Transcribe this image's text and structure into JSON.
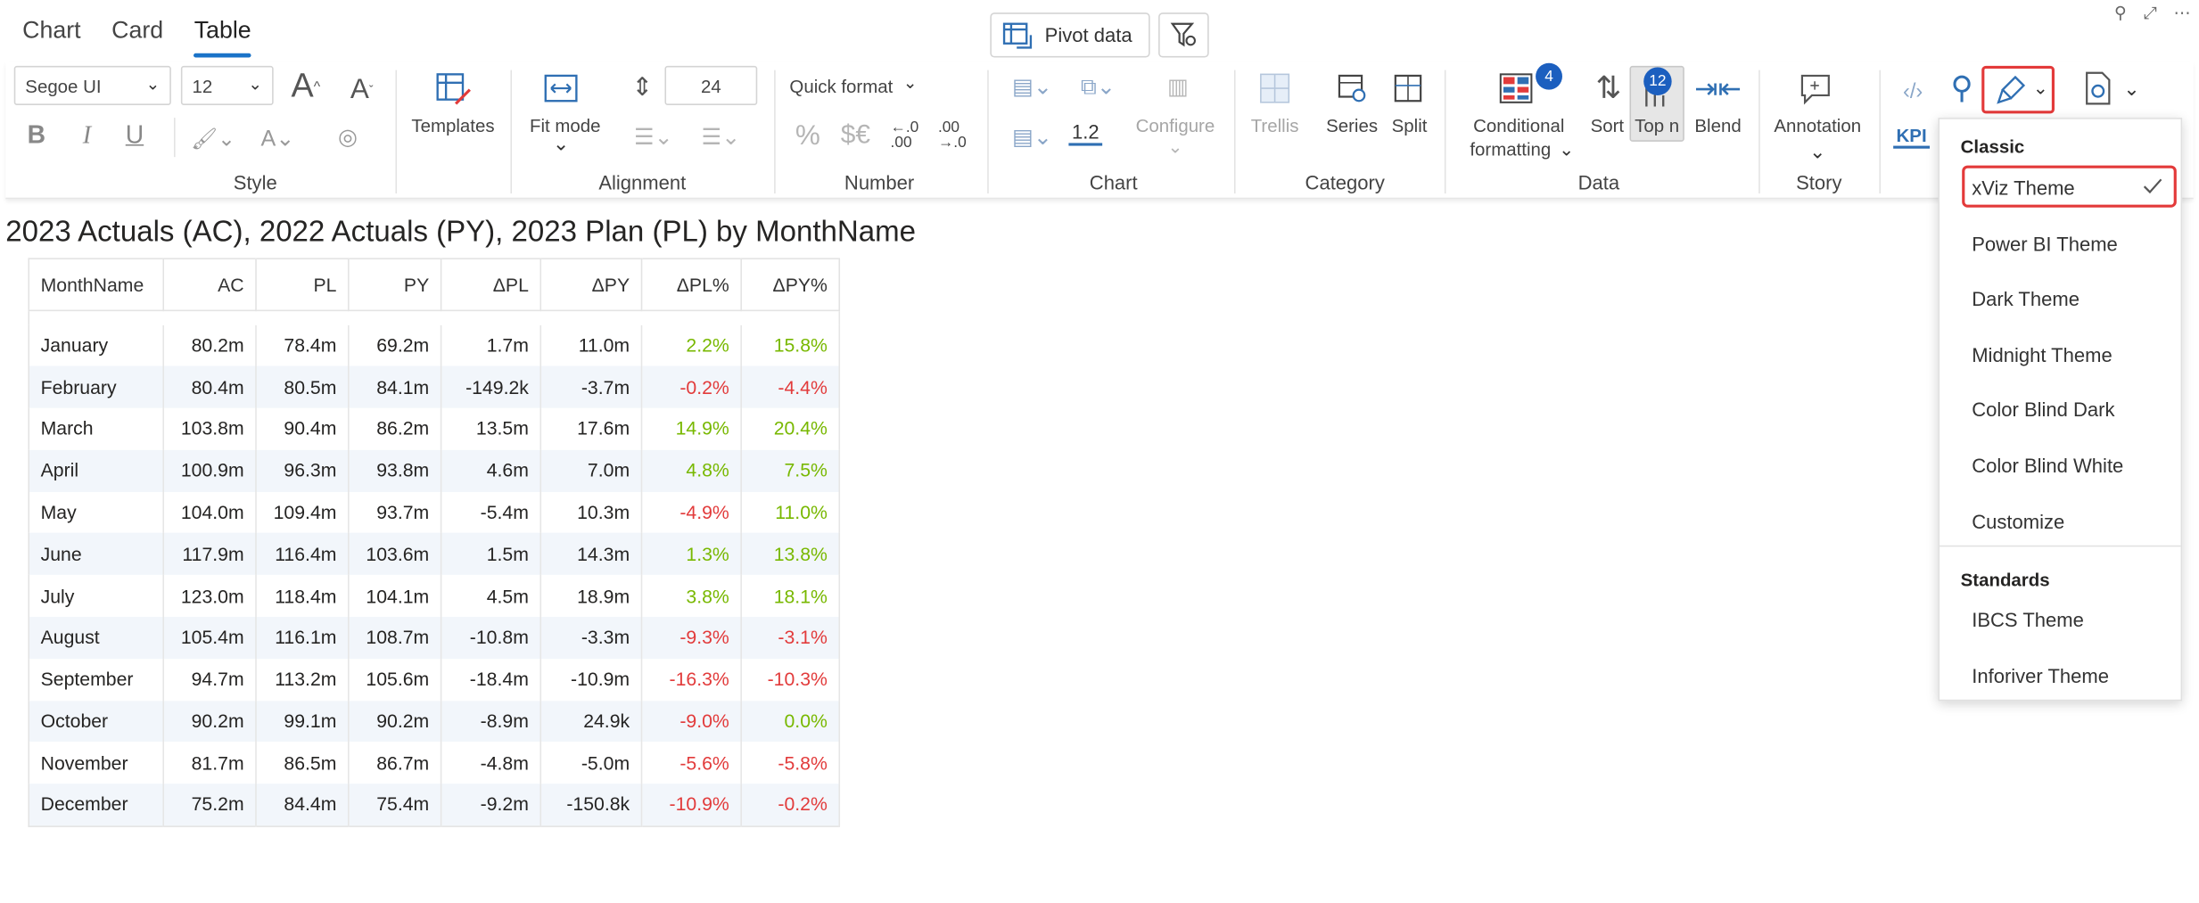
{
  "tabs": [
    {
      "label": "Chart"
    },
    {
      "label": "Card"
    },
    {
      "label": "Table",
      "active": true
    }
  ],
  "pivot": {
    "label": "Pivot data"
  },
  "ribbon": {
    "style": {
      "font": "Segoe UI",
      "size": "12",
      "label": "Style"
    },
    "templates": {
      "label": "Templates"
    },
    "alignment": {
      "fit_mode": "Fit mode",
      "row_height": "24",
      "label": "Alignment"
    },
    "number": {
      "quick_format": "Quick format",
      "label": "Number"
    },
    "chart": {
      "scale": "1.2",
      "configure": "Configure",
      "label": "Chart"
    },
    "category": {
      "trellis": "Trellis",
      "series": "Series",
      "split": "Split",
      "label": "Category"
    },
    "data": {
      "conditional_formatting": "Conditional",
      "conditional_formatting_2": "formatting",
      "cf_count": "4",
      "sort": "Sort",
      "topn": "Top n",
      "topn_count": "12",
      "blend": "Blend",
      "label": "Data"
    },
    "story": {
      "annotation": "Annotation",
      "label": "Story"
    },
    "kpi": {
      "label": "KPI"
    }
  },
  "title": "2023 Actuals (AC), 2022 Actuals (PY), 2023 Plan (PL) by MonthName",
  "table": {
    "headers": [
      "MonthName",
      "AC",
      "PL",
      "PY",
      "ΔPL",
      "ΔPY",
      "ΔPL%",
      "ΔPY%"
    ],
    "rows": [
      [
        "January",
        "80.2m",
        "78.4m",
        "69.2m",
        "1.7m",
        "11.0m",
        "2.2%",
        "15.8%"
      ],
      [
        "February",
        "80.4m",
        "80.5m",
        "84.1m",
        "-149.2k",
        "-3.7m",
        "-0.2%",
        "-4.4%"
      ],
      [
        "March",
        "103.8m",
        "90.4m",
        "86.2m",
        "13.5m",
        "17.6m",
        "14.9%",
        "20.4%"
      ],
      [
        "April",
        "100.9m",
        "96.3m",
        "93.8m",
        "4.6m",
        "7.0m",
        "4.8%",
        "7.5%"
      ],
      [
        "May",
        "104.0m",
        "109.4m",
        "93.7m",
        "-5.4m",
        "10.3m",
        "-4.9%",
        "11.0%"
      ],
      [
        "June",
        "117.9m",
        "116.4m",
        "103.6m",
        "1.5m",
        "14.3m",
        "1.3%",
        "13.8%"
      ],
      [
        "July",
        "123.0m",
        "118.4m",
        "104.1m",
        "4.5m",
        "18.9m",
        "3.8%",
        "18.1%"
      ],
      [
        "August",
        "105.4m",
        "116.1m",
        "108.7m",
        "-10.8m",
        "-3.3m",
        "-9.3%",
        "-3.1%"
      ],
      [
        "September",
        "94.7m",
        "113.2m",
        "105.6m",
        "-18.4m",
        "-10.9m",
        "-16.3%",
        "-10.3%"
      ],
      [
        "October",
        "90.2m",
        "99.1m",
        "90.2m",
        "-8.9m",
        "24.9k",
        "-9.0%",
        "0.0%"
      ],
      [
        "November",
        "81.7m",
        "86.5m",
        "86.7m",
        "-4.8m",
        "-5.0m",
        "-5.6%",
        "-5.8%"
      ],
      [
        "December",
        "75.2m",
        "84.4m",
        "75.4m",
        "-9.2m",
        "-150.8k",
        "-10.9%",
        "-0.2%"
      ]
    ]
  },
  "theme_menu": {
    "classic_label": "Classic",
    "classic": [
      "xViz Theme",
      "Power BI Theme",
      "Dark Theme",
      "Midnight Theme",
      "Color Blind Dark",
      "Color Blind White",
      "Customize"
    ],
    "selected": "xViz Theme",
    "standards_label": "Standards",
    "standards": [
      "IBCS Theme",
      "Inforiver Theme"
    ]
  },
  "colors": {
    "positive": "#78b800",
    "negative": "#e23b3b",
    "accent": "#1a73c8",
    "highlight": "#e33a3a"
  }
}
